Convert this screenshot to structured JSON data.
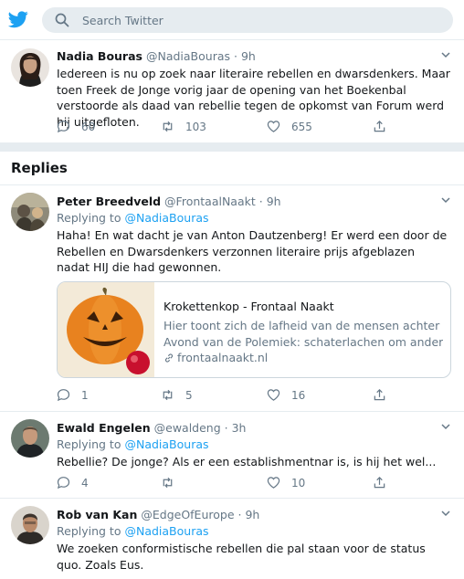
{
  "search": {
    "placeholder": "Search Twitter"
  },
  "main_tweet": {
    "name": "Nadia Bouras",
    "handle": "@NadiaBouras",
    "time": "· 9h",
    "text": "Iedereen is nu op zoek naar literaire rebellen en dwarsdenkers. Maar toen Freek de Jonge vorig jaar de opening van het Boekenbal verstoorde als daad van rebellie tegen de opkomst van Forum werd hij uitgefloten.",
    "replies": "60",
    "retweets": "103",
    "likes": "655"
  },
  "replies_heading": "Replies",
  "replies": [
    {
      "name": "Peter Breedveld",
      "handle": "@FrontaalNaakt",
      "time": "· 9h",
      "replying_prefix": "Replying to",
      "replying_to": "@NadiaBouras",
      "text": "Haha! En wat dacht je van Anton Dautzenberg! Er werd een door de Rebellen en Dwarsdenkers verzonnen literaire prijs afgeblazen nadat HIJ die had gewonnen.",
      "card": {
        "title": "Krokettenkop - Frontaal Naakt",
        "desc_line1": "Hier toont zich de lafheid van de mensen achter de",
        "desc_line2": "Avond van de Polemiek: schaterlachen om andermans...",
        "link": "frontaalnaakt.nl"
      },
      "replies": "1",
      "retweets": "5",
      "likes": "16"
    },
    {
      "name": "Ewald Engelen",
      "handle": "@ewaldeng",
      "time": "· 3h",
      "replying_prefix": "Replying to",
      "replying_to": "@NadiaBouras",
      "text": "Rebellie? De jonge? Als er een establishmentnar is, is hij het wel...",
      "replies": "4",
      "retweets": "",
      "likes": "10"
    },
    {
      "name": "Rob van Kan",
      "handle": "@EdgeOfEurope",
      "time": "· 9h",
      "replying_prefix": "Replying to",
      "replying_to": "@NadiaBouras",
      "text": "We zoeken conformistische rebellen die pal staan voor de status quo. Zoals Eus."
    }
  ],
  "colors": {
    "accent": "#1da1f2",
    "muted": "#657786",
    "divider": "#e6ecf0"
  }
}
